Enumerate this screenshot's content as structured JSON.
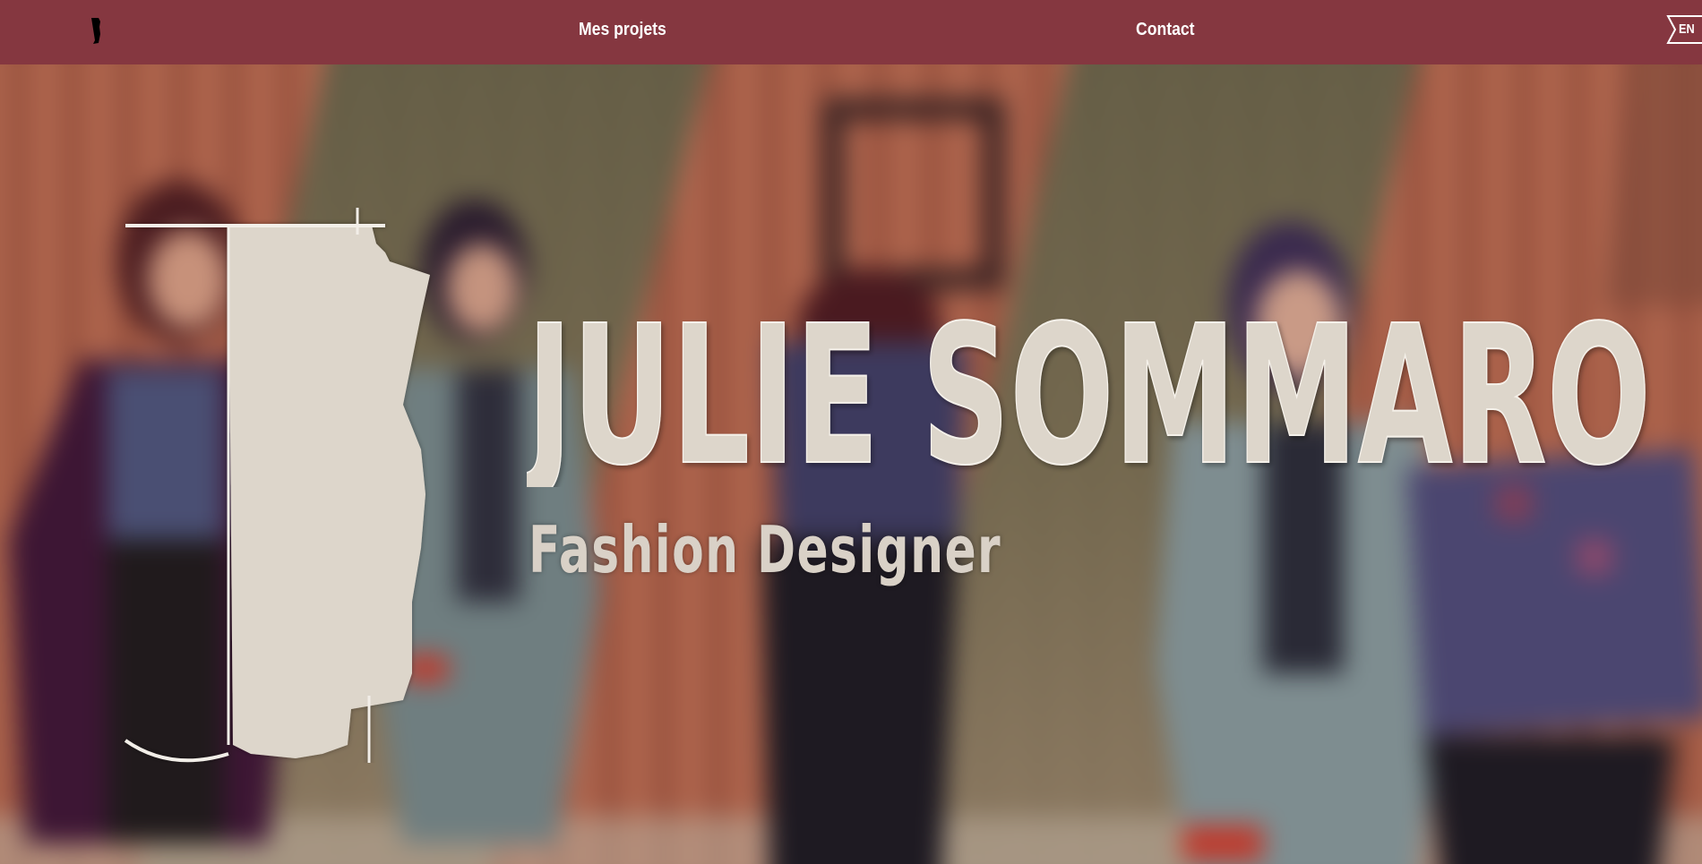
{
  "nav": {
    "projects_label": "Mes projets",
    "contact_label": "Contact",
    "language_label": "EN"
  },
  "hero": {
    "name": "JULIE SOMMARO",
    "role": "Fashion Designer"
  },
  "colors": {
    "navbar": "#853740",
    "logo_cream": "#ddd6cb",
    "text_white": "#ffffff"
  },
  "icons": {
    "logo": "julie-monogram-icon",
    "language": "language-flag-icon"
  }
}
